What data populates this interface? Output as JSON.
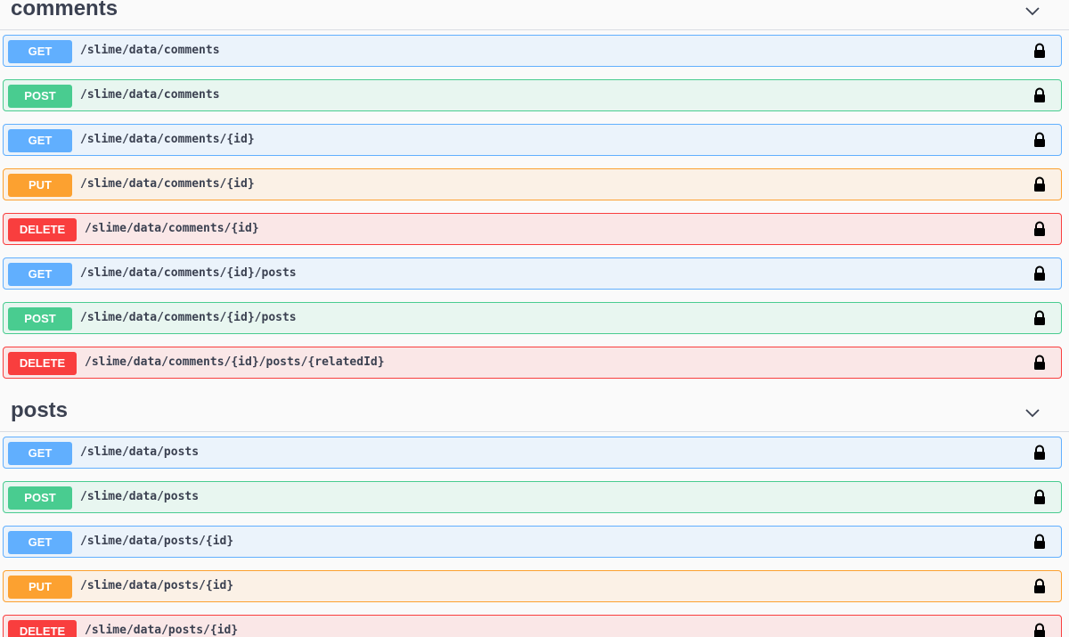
{
  "sections": [
    {
      "title": "comments",
      "icon": "chevron-down-icon",
      "operations": [
        {
          "method": "GET",
          "path": "/slime/data/comments"
        },
        {
          "method": "POST",
          "path": "/slime/data/comments"
        },
        {
          "method": "GET",
          "path": "/slime/data/comments/{id}"
        },
        {
          "method": "PUT",
          "path": "/slime/data/comments/{id}"
        },
        {
          "method": "DELETE",
          "path": "/slime/data/comments/{id}"
        },
        {
          "method": "GET",
          "path": "/slime/data/comments/{id}/posts"
        },
        {
          "method": "POST",
          "path": "/slime/data/comments/{id}/posts"
        },
        {
          "method": "DELETE",
          "path": "/slime/data/comments/{id}/posts/{relatedId}"
        }
      ]
    },
    {
      "title": "posts",
      "icon": "chevron-down-icon",
      "operations": [
        {
          "method": "GET",
          "path": "/slime/data/posts"
        },
        {
          "method": "POST",
          "path": "/slime/data/posts"
        },
        {
          "method": "GET",
          "path": "/slime/data/posts/{id}"
        },
        {
          "method": "PUT",
          "path": "/slime/data/posts/{id}"
        },
        {
          "method": "DELETE",
          "path": "/slime/data/posts/{id}"
        }
      ]
    }
  ],
  "colors": {
    "get": "#61affe",
    "post": "#49cc90",
    "put": "#fca130",
    "delete": "#f93e3e"
  },
  "lock_icon": "lock-icon"
}
